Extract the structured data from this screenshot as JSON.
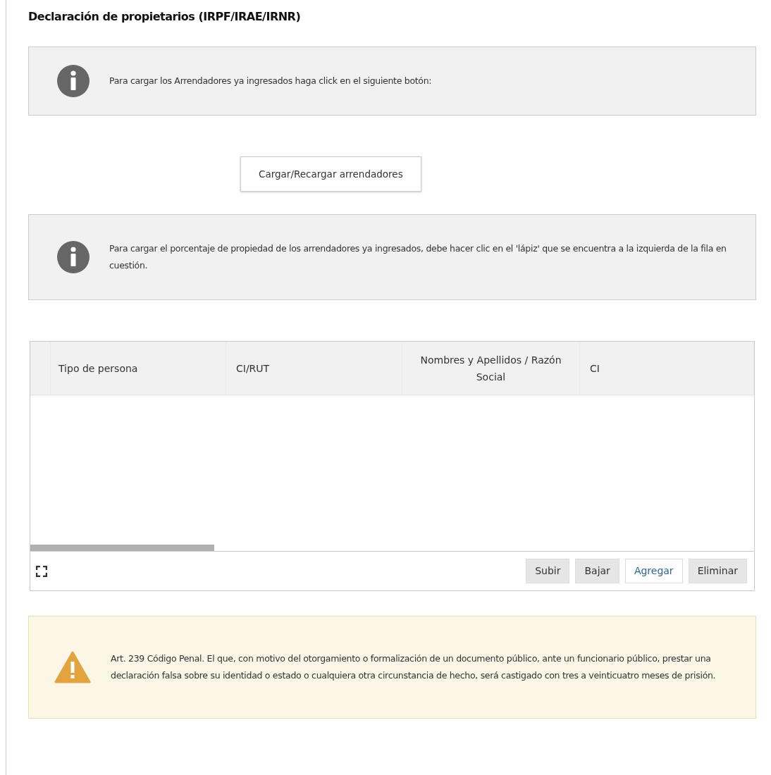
{
  "title": "Declaración de propietarios (IRPF/IRAE/IRNR)",
  "notices": [
    {
      "kind": "info",
      "text": "Para cargar los Arrendadores ya ingresados haga click en el siguiente botón:"
    }
  ],
  "load_button": "Cargar/Recargar arrendadores",
  "notices2": [
    {
      "kind": "info",
      "text": "Para cargar el porcentaje de propiedad de los arrendadores ya ingresados, debe hacer clic en el 'lápiz' que se encuentra a la izquierda de la fila en cuestión."
    }
  ],
  "table": {
    "columns": [
      "Tipo de persona",
      "CI/RUT",
      "Nombres y Apellidos / Razón Social",
      "CI"
    ],
    "buttons": [
      {
        "label": "Subir",
        "disabled": true
      },
      {
        "label": "Bajar",
        "disabled": true
      },
      {
        "label": "Agregar",
        "disabled": false
      },
      {
        "label": "Eliminar",
        "disabled": true
      }
    ]
  },
  "warning": {
    "kind": "warning",
    "text": "Art. 239 Código Penal. El que, con motivo del otorgamiento o formalización de un documento público, ante un funcionario público, prestar una declaración falsa sobre su identidad o estado o cualquiera otra circunstancia de hecho, será castigado con tres a veinticuatro meses de prisión."
  }
}
